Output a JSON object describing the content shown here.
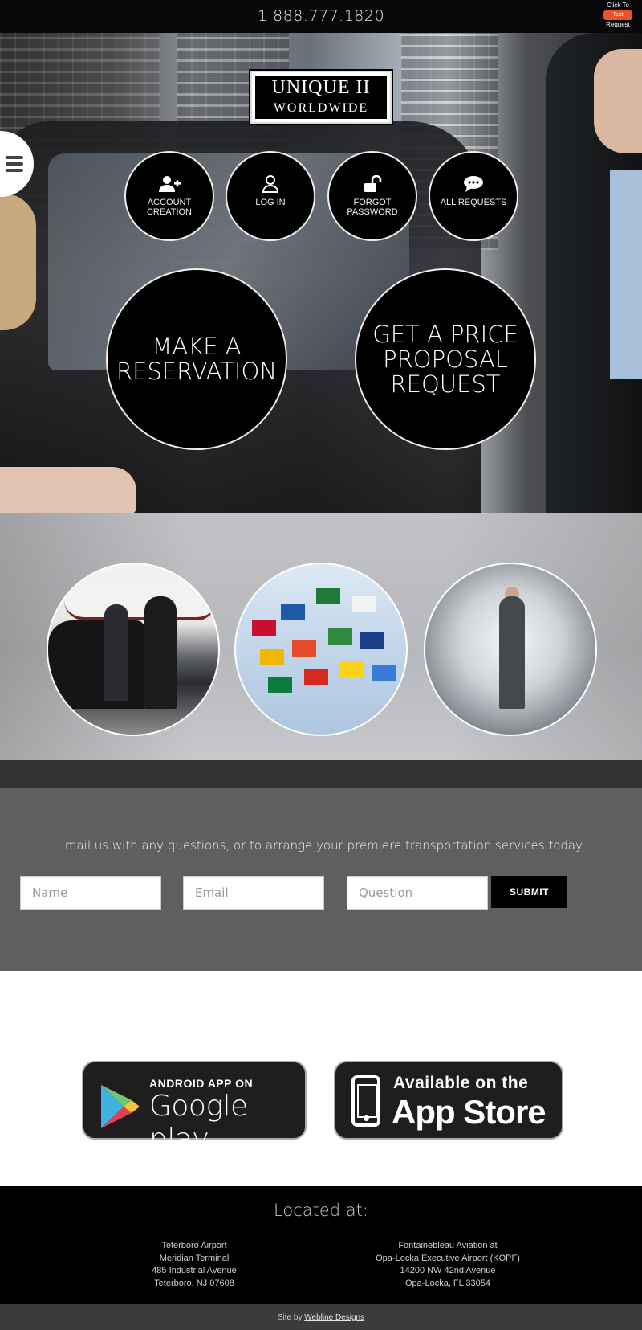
{
  "topbar": {
    "phone": "1.888.777.1820",
    "text_widget": {
      "top": "Click To",
      "pill": "Text",
      "bottom": "Request"
    }
  },
  "logo": {
    "line1": "UNIQUE II",
    "line2": "WORLDWIDE"
  },
  "menu": {
    "icon": "hamburger-icon"
  },
  "quick_actions": [
    {
      "label": "ACCOUNT CREATION",
      "icon": "add-user-icon"
    },
    {
      "label": "LOG IN",
      "icon": "user-icon"
    },
    {
      "label": "FORGOT PASSWORD",
      "icon": "unlock-icon"
    },
    {
      "label": "ALL REQUESTS",
      "icon": "chat-bubble-icon"
    }
  ],
  "cta": {
    "reservation": "MAKE A RESERVATION",
    "proposal": "GET A PRICE PROPOSAL REQUEST"
  },
  "contact": {
    "intro": "Email us with any questions, or to arrange your premiere transportation services today.",
    "name_placeholder": "Name",
    "email_placeholder": "Email",
    "question_placeholder": "Question",
    "submit_label": "SUBMIT"
  },
  "apps": {
    "google": {
      "line1": "ANDROID APP ON",
      "line2": "Google play"
    },
    "apple": {
      "line1": "Available on the",
      "line2": "App Store"
    }
  },
  "footer": {
    "heading": "Located at:",
    "address1": [
      "Teterboro Airport",
      "Meridian Terminal",
      "485 Industrial Avenue",
      "Teterboro, NJ 07608"
    ],
    "address2": [
      "Fontainebleau Aviation at",
      "Opa-Locka Executive Airport (KOPF)",
      "14200 NW 42nd Avenue",
      "Opa-Locka, FL 33054"
    ],
    "credit_prefix": "Site by",
    "credit_link": "Webline Designs"
  },
  "colors": {
    "bar": "#080808",
    "text_pill": "#e8532b",
    "contact_bg": "#5f5f5f"
  }
}
